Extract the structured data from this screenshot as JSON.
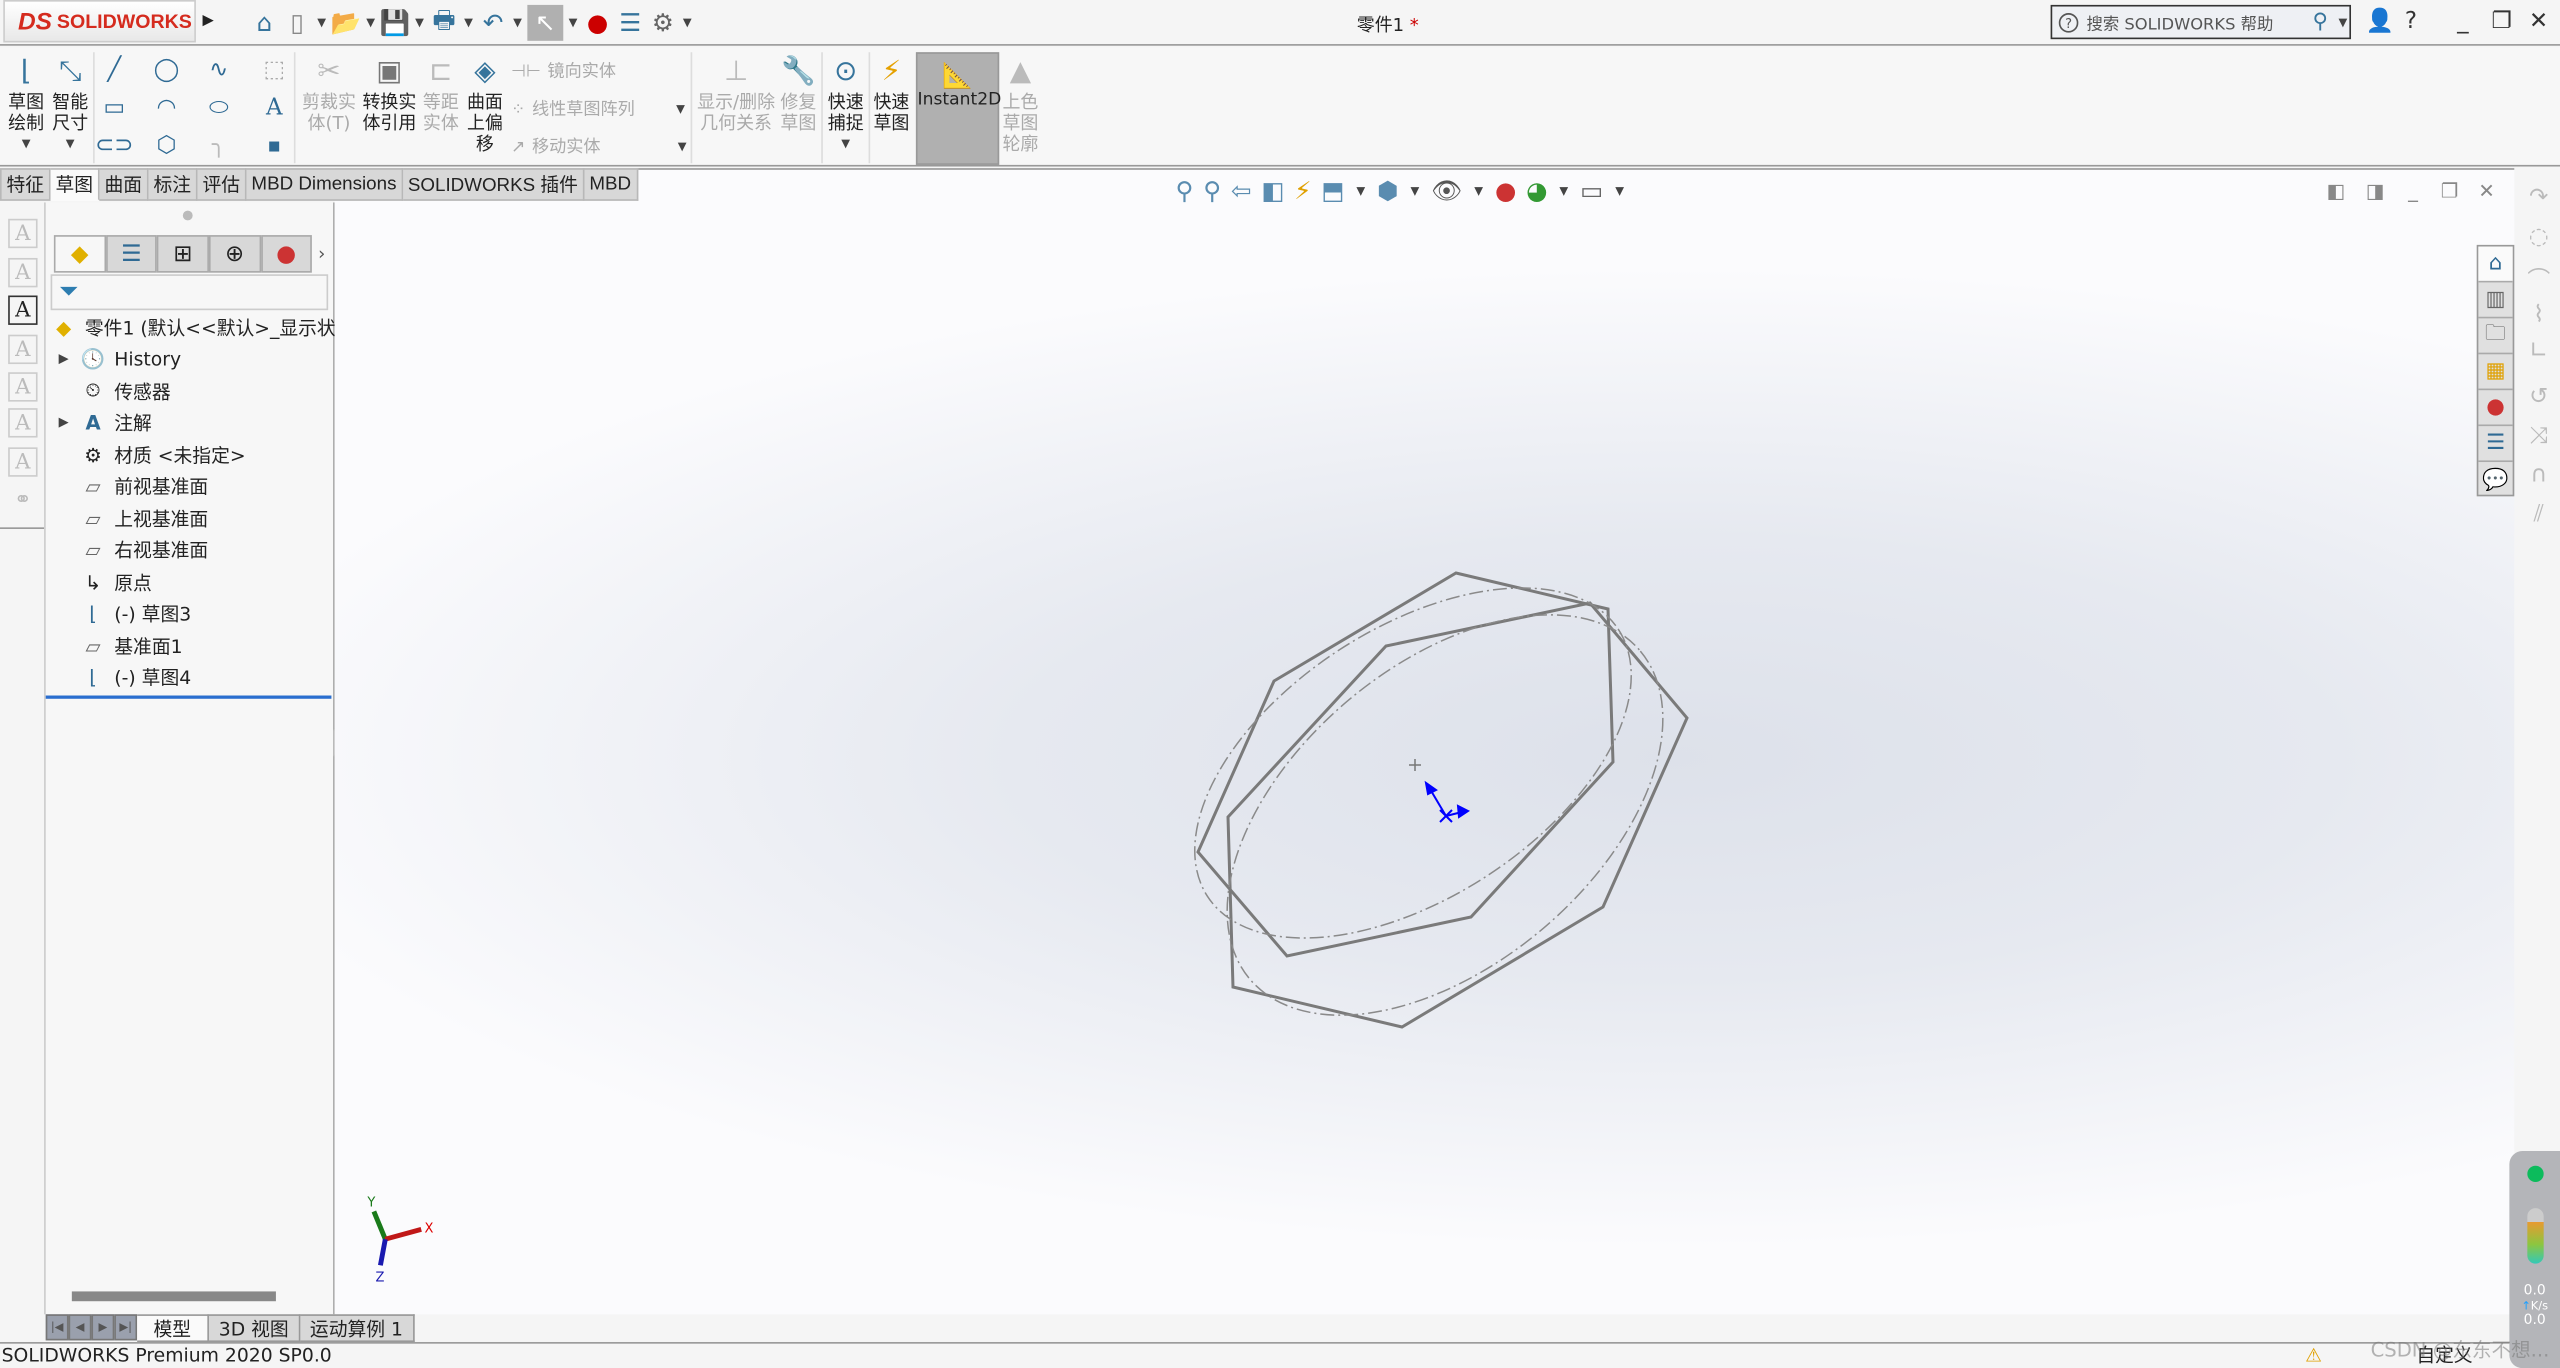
{
  "app": {
    "logo_text": "SOLIDWORKS",
    "document_title": "零件1",
    "modified_marker": "*"
  },
  "quick_access": {
    "icons": [
      "home-icon",
      "new-document-icon",
      "open-icon",
      "save-icon",
      "print-icon",
      "undo-icon",
      "select-icon",
      "rebuild-icon",
      "file-properties-icon",
      "options-gear-icon"
    ]
  },
  "search": {
    "placeholder": "搜索 SOLIDWORKS 帮助"
  },
  "ribbon": {
    "sketch": {
      "line1": "草图",
      "line2": "绘制"
    },
    "smart_dim": {
      "line1": "智能",
      "line2": "尺寸"
    },
    "trim": {
      "line1": "剪裁实",
      "line2": "体(T)"
    },
    "convert": {
      "line1": "转换实",
      "line2": "体引用"
    },
    "offset": {
      "line1": "等距",
      "line2": "实体"
    },
    "surface_offset": {
      "line1": "曲面",
      "line2": "上偏",
      "line3": "移"
    },
    "mirror": "镜向实体",
    "linear_pattern": "线性草图阵列",
    "move": "移动实体",
    "relations": {
      "line1": "显示/删除",
      "line2": "几何关系"
    },
    "repair": {
      "line1": "修复",
      "line2": "草图"
    },
    "quick_snap": {
      "line1": "快速",
      "line2": "捕捉"
    },
    "rapid_sketch": {
      "line1": "快速",
      "line2": "草图"
    },
    "instant2d": "Instant2D",
    "shaded_sketch": {
      "line1": "上色",
      "line2": "草图",
      "line3": "轮廓"
    }
  },
  "command_tabs": [
    "特征",
    "草图",
    "曲面",
    "标注",
    "评估",
    "MBD Dimensions",
    "SOLIDWORKS 插件",
    "MBD"
  ],
  "active_command_tab": "草图",
  "feature_tree": {
    "root": "零件1  (默认<<默认>_显示状态",
    "items": [
      "History",
      "传感器",
      "注解",
      "材质 <未指定>",
      "前视基准面",
      "上视基准面",
      "右视基准面",
      "原点",
      "(-) 草图3",
      "基准面1",
      "(-) 草图4"
    ]
  },
  "triad": {
    "x": "X",
    "y": "Y",
    "z": "Z"
  },
  "bottom_tabs": [
    "模型",
    "3D 视图",
    "运动算例 1"
  ],
  "status": {
    "version": "SOLIDWORKS Premium 2020 SP0.0",
    "customize": "自定义"
  },
  "net_widget": {
    "upload": "0.0",
    "download": "0.0",
    "unit": "K/s"
  },
  "watermark": "CSDN @东东不想...",
  "colors": {
    "accent": "#36749c",
    "active_tab": "#b0b0b0",
    "sketch_line": "#7a7a7a",
    "origin_blue": "#0000ff",
    "logo_red": "#d52b1e"
  }
}
